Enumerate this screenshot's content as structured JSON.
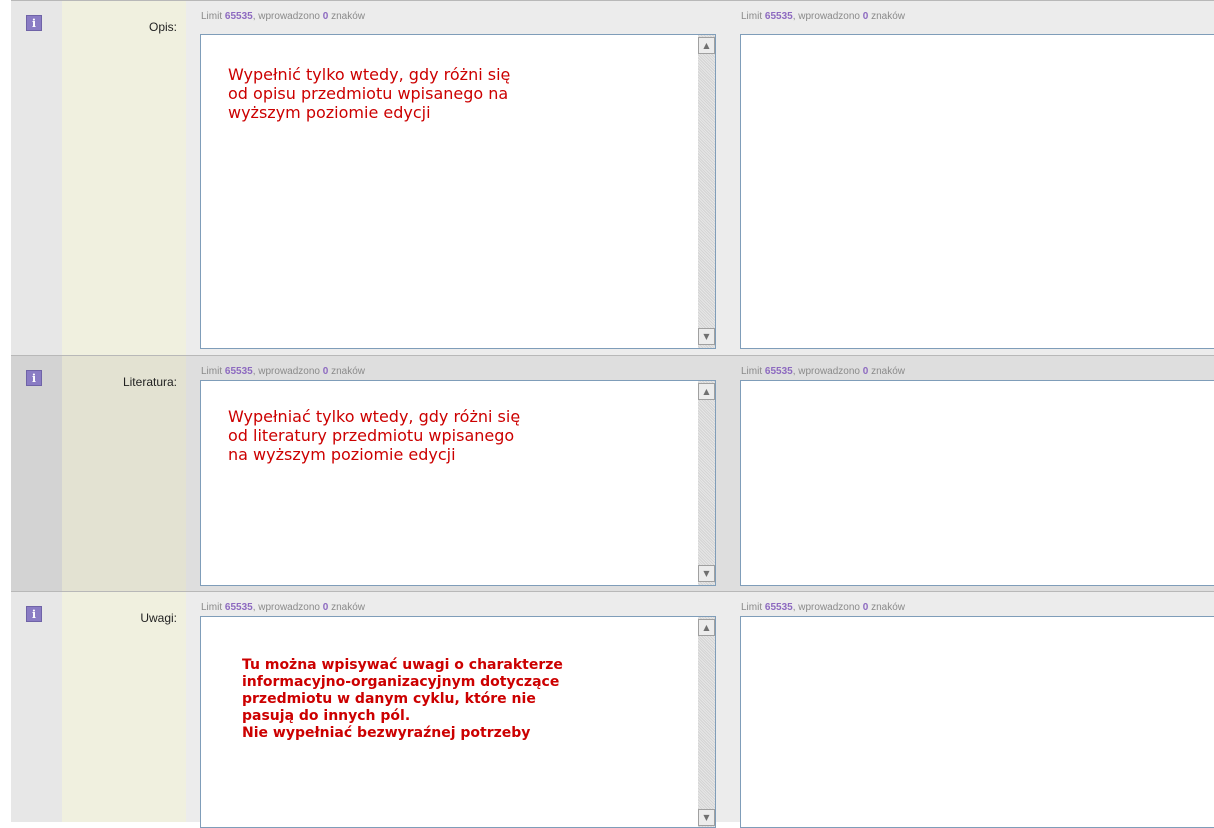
{
  "rows": [
    {
      "label": "Opis:",
      "limit_prefix": "Limit ",
      "limit_value": "65535",
      "entered_prefix": ", wprowadzono ",
      "entered_value": "0",
      "entered_suffix": " znaków",
      "primary_text": "Wypełnić tylko wtedy, gdy różni się\nod opisu przedmiotu wpisanego na\nwyższym poziomie edycji",
      "secondary_text": ""
    },
    {
      "label": "Literatura:",
      "limit_prefix": "Limit ",
      "limit_value": "65535",
      "entered_prefix": ", wprowadzono ",
      "entered_value": "0",
      "entered_suffix": " znaków",
      "primary_text": "Wypełniać tylko wtedy, gdy różni się\nod literatury przedmiotu wpisanego\nna wyższym poziomie edycji",
      "secondary_text": ""
    },
    {
      "label": "Uwagi:",
      "limit_prefix": "Limit ",
      "limit_value": "65535",
      "entered_prefix": ", wprowadzono ",
      "entered_value": "0",
      "entered_suffix": " znaków",
      "primary_text": "Tu można wpisywać uwagi o charakterze\ninformacyjno-organizacyjnym dotyczące\nprzedmiotu w danym cyklu, które nie\npasują do innych pól.\nNie wypełniać bezwyraźnej potrzeby",
      "secondary_text": ""
    }
  ],
  "info_icon_glyph": "i",
  "scroll_up_glyph": "▲",
  "scroll_down_glyph": "▼"
}
